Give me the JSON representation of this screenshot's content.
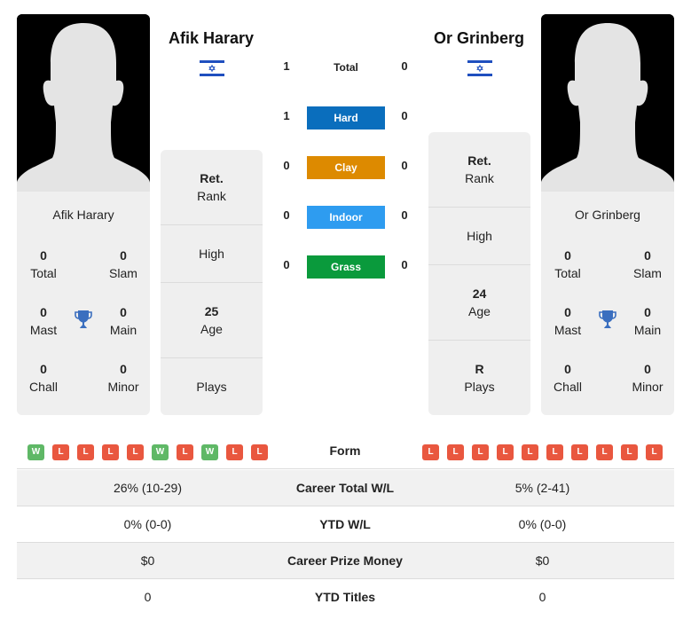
{
  "players": [
    {
      "name": "Afik Harary",
      "card_name": "Afik Harary",
      "flag": "israel-flag",
      "titles": {
        "total": {
          "value": "0",
          "label": "Total"
        },
        "slam": {
          "value": "0",
          "label": "Slam"
        },
        "mast": {
          "value": "0",
          "label": "Mast"
        },
        "main": {
          "value": "0",
          "label": "Main"
        },
        "chall": {
          "value": "0",
          "label": "Chall"
        },
        "minor": {
          "value": "0",
          "label": "Minor"
        }
      },
      "info": {
        "rank": {
          "value": "Ret.",
          "label": "Rank"
        },
        "high": {
          "value": "",
          "label": "High"
        },
        "age": {
          "value": "25",
          "label": "Age"
        },
        "plays": {
          "value": "",
          "label": "Plays"
        }
      },
      "form": [
        "W",
        "L",
        "L",
        "L",
        "L",
        "W",
        "L",
        "W",
        "L",
        "L"
      ]
    },
    {
      "name": "Or Grinberg",
      "card_name": "Or Grinberg",
      "flag": "israel-flag",
      "titles": {
        "total": {
          "value": "0",
          "label": "Total"
        },
        "slam": {
          "value": "0",
          "label": "Slam"
        },
        "mast": {
          "value": "0",
          "label": "Mast"
        },
        "main": {
          "value": "0",
          "label": "Main"
        },
        "chall": {
          "value": "0",
          "label": "Chall"
        },
        "minor": {
          "value": "0",
          "label": "Minor"
        }
      },
      "info": {
        "rank": {
          "value": "Ret.",
          "label": "Rank"
        },
        "high": {
          "value": "",
          "label": "High"
        },
        "age": {
          "value": "24",
          "label": "Age"
        },
        "plays": {
          "value": "R",
          "label": "Plays"
        }
      },
      "form": [
        "L",
        "L",
        "L",
        "L",
        "L",
        "L",
        "L",
        "L",
        "L",
        "L"
      ]
    }
  ],
  "h2h": {
    "total": {
      "label": "Total",
      "left": "1",
      "right": "0"
    },
    "surfaces": [
      {
        "label": "Hard",
        "left": "1",
        "right": "0",
        "color": "#0a6ebd"
      },
      {
        "label": "Clay",
        "left": "0",
        "right": "0",
        "color": "#dd8a00"
      },
      {
        "label": "Indoor",
        "left": "0",
        "right": "0",
        "color": "#2e9cf0"
      },
      {
        "label": "Grass",
        "left": "0",
        "right": "0",
        "color": "#0a9a3c"
      }
    ]
  },
  "form_label": "Form",
  "stats": [
    {
      "label": "Career Total W/L",
      "left": "26% (10-29)",
      "right": "5% (2-41)"
    },
    {
      "label": "YTD W/L",
      "left": "0% (0-0)",
      "right": "0% (0-0)"
    },
    {
      "label": "Career Prize Money",
      "left": "$0",
      "right": "$0"
    },
    {
      "label": "YTD Titles",
      "left": "0",
      "right": "0"
    }
  ],
  "colors": {
    "win": "#5fb866",
    "loss": "#e9573f",
    "trophy": "#3b6fbf",
    "flag_blue": "#1f4fbf"
  }
}
